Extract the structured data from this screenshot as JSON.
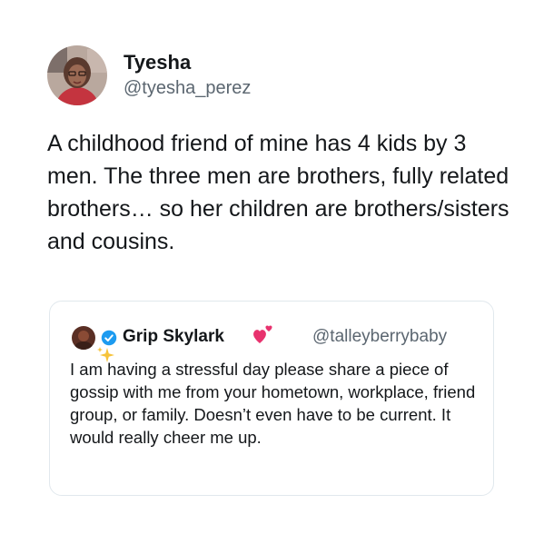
{
  "tweet": {
    "author": {
      "display_name": "Tyesha",
      "handle": "@tyesha_perez",
      "avatar_icon": "profile-photo"
    },
    "text": "A childhood friend of mine has 4 kids by 3 men. The three men are brothers, fully related brothers… so her children are brothers/sisters and cousins.",
    "quoted_tweet": {
      "author": {
        "display_name": "Grip Skylark",
        "handle": "@talleyberrybaby",
        "verified_icon": "verified-badge-icon",
        "emoji_icon": "two-hearts-icon"
      },
      "sparkle_icon": "sparkles-icon",
      "text": "I am having a stressful day please share a piece of gossip with me from your hometown, workplace, friend group, or family. Doesn’t even have to be current. It would really cheer me up."
    }
  },
  "colors": {
    "text_primary": "#14171a",
    "text_secondary": "#5b6670",
    "verified_blue": "#1d9bf0",
    "heart_pink": "#e8326e",
    "border": "#e1e8ed"
  }
}
